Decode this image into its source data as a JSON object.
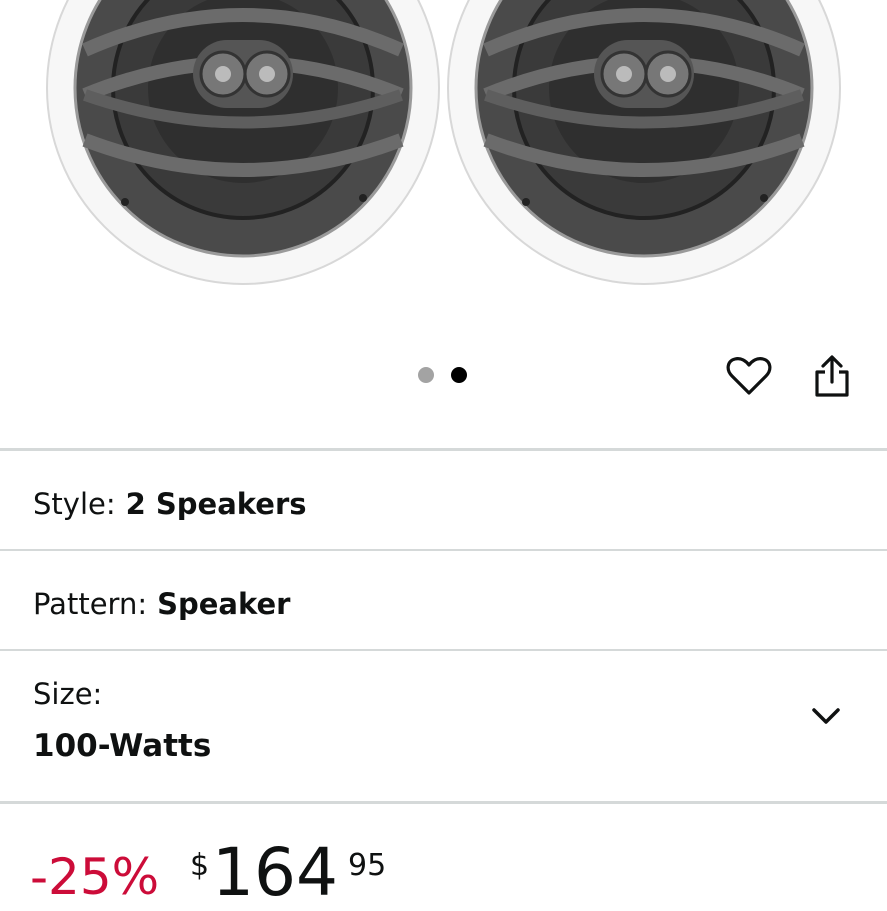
{
  "gallery": {
    "image_alt": "Two in-ceiling speakers",
    "pager": {
      "total": 2,
      "active_index": 1
    },
    "icons": {
      "wishlist": "heart-icon",
      "share": "share-icon"
    }
  },
  "options": {
    "style": {
      "label": "Style:",
      "value": "2 Speakers"
    },
    "pattern": {
      "label": "Pattern:",
      "value": "Speaker"
    },
    "size": {
      "label": "Size:",
      "value": "100-Watts",
      "icon": "chevron-down-icon"
    }
  },
  "price": {
    "discount": "-25%",
    "currency": "$",
    "whole": "164",
    "fraction": "95"
  },
  "colors": {
    "discount": "#cc0c39",
    "divider": "#d5d9d9",
    "dot_active": "#000000",
    "dot_inactive": "#a3a3a3"
  }
}
